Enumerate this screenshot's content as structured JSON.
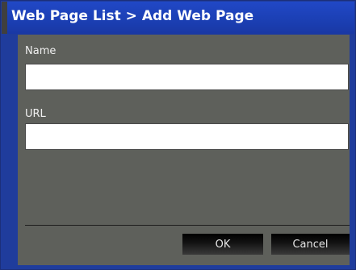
{
  "dialog": {
    "title": "Web Page List > Add Web Page"
  },
  "form": {
    "name_label": "Name",
    "name_value": "",
    "url_label": "URL",
    "url_value": ""
  },
  "buttons": {
    "ok_label": "OK",
    "cancel_label": "Cancel"
  },
  "colors": {
    "titlebar": "#1b3fb3",
    "body": "#5e605b",
    "button": "#111111"
  }
}
